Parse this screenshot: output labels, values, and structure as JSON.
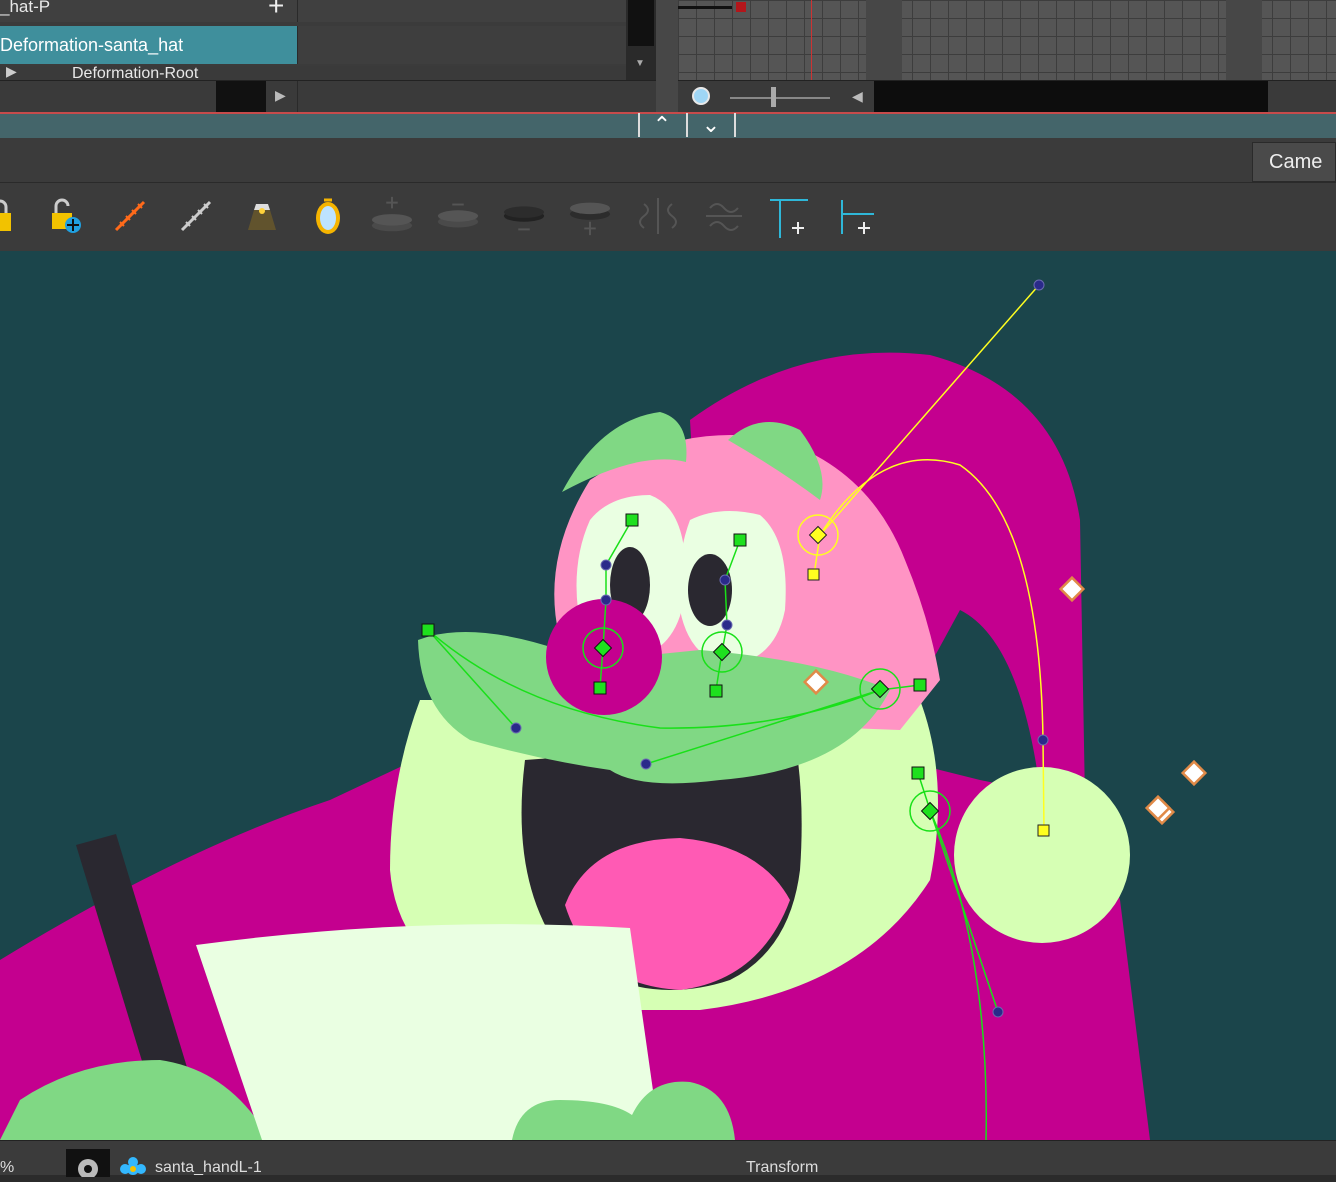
{
  "layers": {
    "row_hat_label": "_hat-P",
    "row_deform_label": "Deformation-santa_hat",
    "row_root_label": "Deformation-Root"
  },
  "camera_tab": {
    "label": "Came"
  },
  "toolbar": {
    "icons": [
      "lock-icon",
      "unlock-add-icon",
      "orange-chain-icon",
      "gray-chain-icon",
      "lamp-icon",
      "mirror-icon",
      "add-layer-top-icon",
      "remove-layer-icon",
      "layer-minus-icon",
      "layer-add-bottom-icon",
      "flip-horizontal-icon",
      "flip-vertical-icon",
      "add-peg-icon",
      "add-pivot-icon"
    ]
  },
  "status": {
    "zoom_fragment": "%",
    "drawing_name": "santa_handL-1",
    "mode_label": "Transform"
  },
  "colors": {
    "viewport_bg": "#1b454b",
    "hat_magenta": "#c4008f",
    "face_pink": "#ff94c4",
    "green": "#80d884",
    "pale_green": "#d6ffb4",
    "dark": "#2a2830",
    "selected_layer": "#3f8f9c"
  }
}
